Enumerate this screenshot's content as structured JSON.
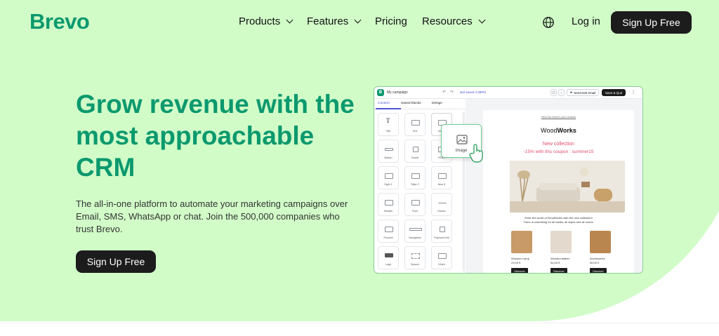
{
  "nav": {
    "logo": "Brevo",
    "items": [
      {
        "label": "Products",
        "has_dropdown": true
      },
      {
        "label": "Features",
        "has_dropdown": true
      },
      {
        "label": "Pricing",
        "has_dropdown": false
      },
      {
        "label": "Resources",
        "has_dropdown": true
      }
    ],
    "language_icon": "globe-icon",
    "login": "Log in",
    "signup": "Sign Up Free"
  },
  "hero": {
    "headline": "Grow revenue with the most approachable CRM",
    "subtext": "The all-in-one platform to automate your marketing campaigns over Email, SMS, WhatsApp or chat. Join the 500,000 companies who trust Brevo.",
    "cta": "Sign Up Free"
  },
  "editor": {
    "campaign_name": "My campaign",
    "last_saved": "last saved 4:39PM",
    "send_test": "Send test email",
    "save_quit": "Save & Quit",
    "tabs": [
      "Content",
      "Saved blocks",
      "Design"
    ],
    "blocks": [
      {
        "label": "Title"
      },
      {
        "label": "Text"
      },
      {
        "label": "Image"
      },
      {
        "label": "Button"
      },
      {
        "label": "Social"
      },
      {
        "label": "HTML"
      },
      {
        "label": "Style 1"
      },
      {
        "label": "Style 2"
      },
      {
        "label": "Item 3"
      },
      {
        "label": "Header"
      },
      {
        "label": "Form"
      },
      {
        "label": "Divider"
      },
      {
        "label": "Product"
      },
      {
        "label": "Navigation"
      },
      {
        "label": "Payment link"
      },
      {
        "label": "Logo"
      },
      {
        "label": "Spacer"
      },
      {
        "label": "Video"
      }
    ],
    "drag_label": "Image",
    "email": {
      "view_in_browser": "View this email in your browser",
      "brand_pre": "Wood",
      "brand_bold": "Works",
      "collection": "New collection",
      "coupon": "-15% with this coupon : summer15",
      "intro_line1": "Enter the world of WoodWorks with the new collection!",
      "intro_line2": "There is something for all tastes, all styles and all rooms.",
      "products": [
        {
          "name": "Wooden Lamp",
          "price": "23,00 €",
          "button": "Discover"
        },
        {
          "name": "Wooden platter",
          "price": "94,00 €",
          "button": "Discover"
        },
        {
          "name": "Accessories",
          "price": "55,00 €",
          "button": "Discover"
        }
      ]
    }
  },
  "colors": {
    "brand_green": "#0b996e",
    "hero_bg": "#d1fcc8",
    "dark_button": "#1c1c1c",
    "coupon_pink": "#e04a6a"
  }
}
